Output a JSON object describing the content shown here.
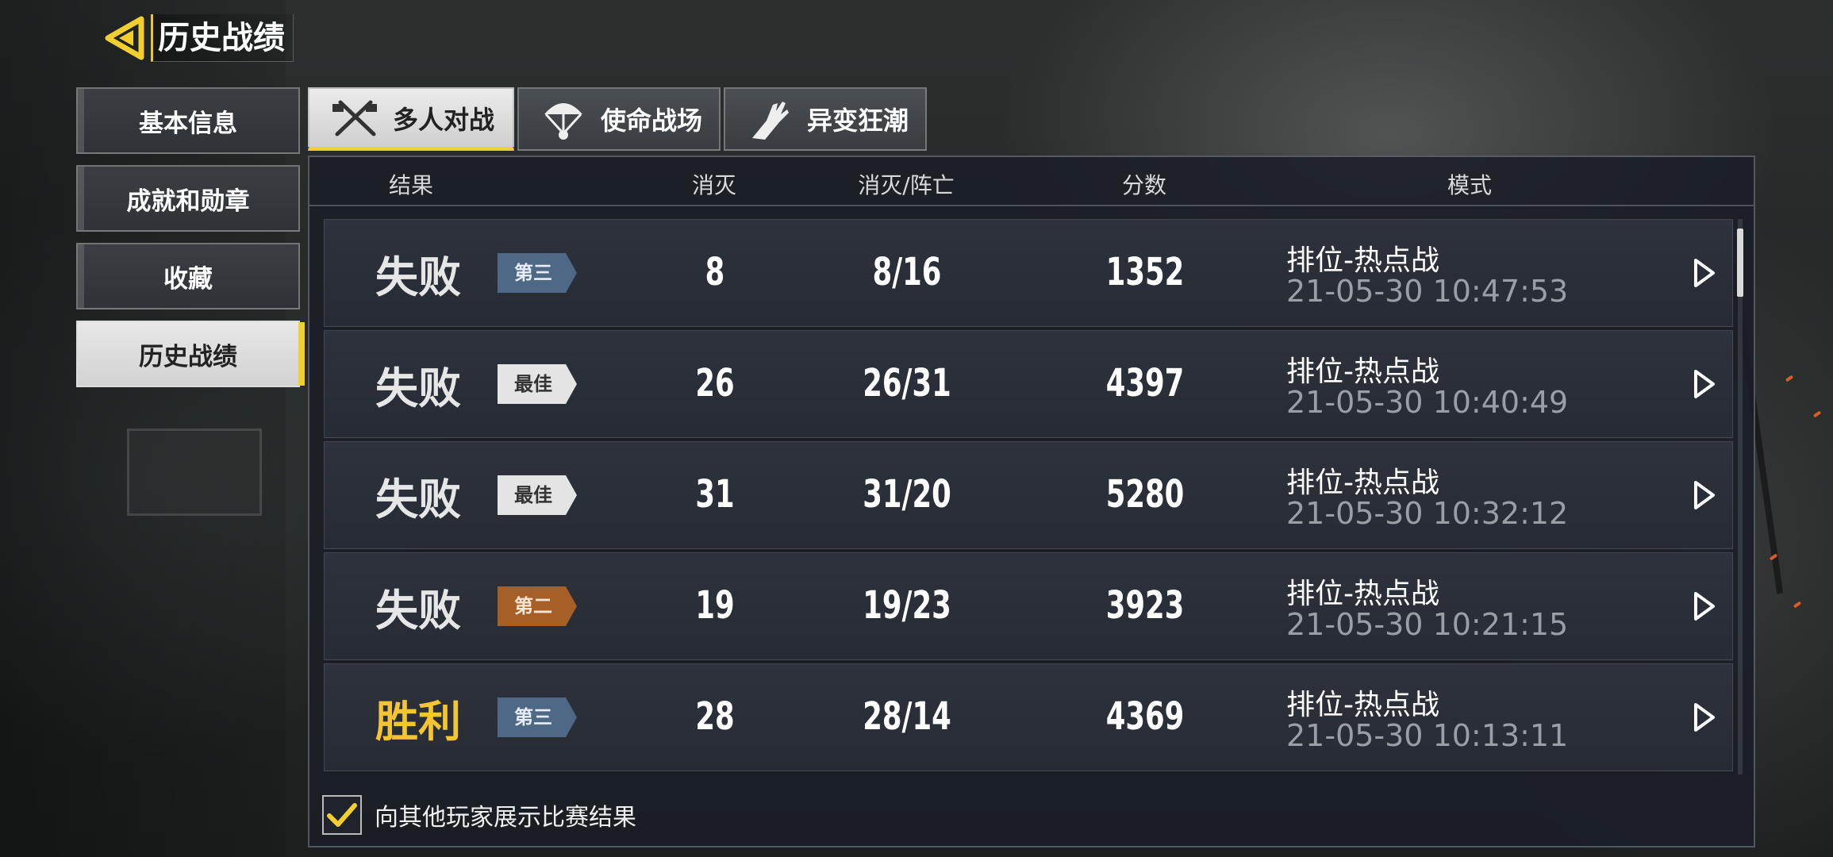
{
  "header": {
    "title": "历史战绩",
    "back_icon": "chevron-left-icon",
    "accent": "#f2cf2e"
  },
  "sidebar": {
    "items": [
      {
        "label": "基本信息",
        "active": false
      },
      {
        "label": "成就和勋章",
        "active": false
      },
      {
        "label": "收藏",
        "active": false
      },
      {
        "label": "历史战绩",
        "active": true
      }
    ]
  },
  "tabs": [
    {
      "label": "多人对战",
      "icon": "crossed-weapons-icon",
      "active": true
    },
    {
      "label": "使命战场",
      "icon": "parachute-icon",
      "active": false
    },
    {
      "label": "异变狂潮",
      "icon": "zombie-arm-icon",
      "active": false
    }
  ],
  "table": {
    "columns": [
      "结果",
      "消灭",
      "消灭/阵亡",
      "分数",
      "模式"
    ],
    "rows": [
      {
        "result": "失败",
        "badge": "第三",
        "kills": "8",
        "kd": "8/16",
        "score": "1352",
        "mode": "排位-热点战",
        "time": "21-05-30 10:47:53"
      },
      {
        "result": "失败",
        "badge": "最佳",
        "kills": "26",
        "kd": "26/31",
        "score": "4397",
        "mode": "排位-热点战",
        "time": "21-05-30 10:40:49"
      },
      {
        "result": "失败",
        "badge": "最佳",
        "kills": "31",
        "kd": "31/20",
        "score": "5280",
        "mode": "排位-热点战",
        "time": "21-05-30 10:32:12"
      },
      {
        "result": "失败",
        "badge": "第二",
        "kills": "19",
        "kd": "19/23",
        "score": "3923",
        "mode": "排位-热点战",
        "time": "21-05-30 10:21:15"
      },
      {
        "result": "胜利",
        "badge": "第三",
        "kills": "28",
        "kd": "28/14",
        "score": "4369",
        "mode": "排位-热点战",
        "time": "21-05-30 10:13:11"
      }
    ]
  },
  "footer": {
    "checkbox_label": "向其他玩家展示比赛结果",
    "checked": true
  },
  "colors": {
    "win": "#f5c531",
    "loss": "#e6e6e6",
    "badge_third": "#4e6885",
    "badge_best": "#e4e4e4",
    "badge_second": "#a75f28"
  }
}
